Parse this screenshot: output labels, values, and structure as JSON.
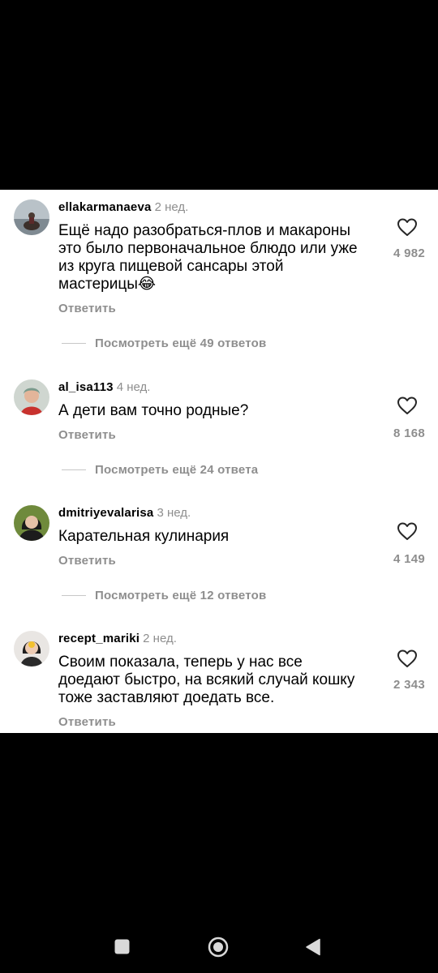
{
  "comments": [
    {
      "username": "ellakarmanaeva",
      "time": "2 нед.",
      "lines": [
        "Ещё надо разобраться-плов и макароны",
        "это было первоначальное блюдо или уже",
        "из круга пищевой сансары этой",
        "мастерицы😂"
      ],
      "reply": "Ответить",
      "likes": "4 982",
      "more_replies": "Посмотреть ещё 49 ответов",
      "avatar_icon": "user-avatar"
    },
    {
      "username": "al_isa113",
      "time": "4 нед.",
      "lines": [
        "А дети вам точно родные?"
      ],
      "reply": "Ответить",
      "likes": "8 168",
      "more_replies": "Посмотреть ещё 24 ответа",
      "avatar_icon": "user-avatar"
    },
    {
      "username": "dmitriyevalarisa",
      "time": "3 нед.",
      "lines": [
        "Карательная кулинария"
      ],
      "reply": "Ответить",
      "likes": "4 149",
      "more_replies": "Посмотреть ещё 12 ответов",
      "avatar_icon": "user-avatar"
    },
    {
      "username": "recept_mariki",
      "time": "2 нед.",
      "lines": [
        "Своим показала, теперь у нас все",
        "доедают быстро, на всякий случай кошку",
        "тоже заставляют доедать все."
      ],
      "reply": "Ответить",
      "likes": "2 343",
      "avatar_icon": "user-avatar"
    }
  ],
  "icons": {
    "like": "heart-outline-icon",
    "nav_recents": "square-icon",
    "nav_home": "circle-icon",
    "nav_back": "triangle-back-icon"
  },
  "colors": {
    "text": "#000000",
    "secondary": "#8e8e8e",
    "background": "#ffffff",
    "letterbox": "#000000"
  }
}
